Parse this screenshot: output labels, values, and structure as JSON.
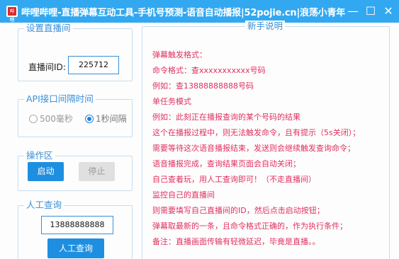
{
  "window": {
    "icon_text": "哔哩",
    "title": "哔哩哔哩-直播弹幕互动工具-手机号预测-语音自动播报|52pojie.cn|浪荡小青年",
    "minimize_glyph": "—",
    "maximize_glyph": "☐",
    "close_glyph": "✕"
  },
  "set_room": {
    "legend": "设置直播间",
    "label": "直播间ID:",
    "room_id": "225712"
  },
  "api_interval": {
    "legend": "API接口间隔时间",
    "options": [
      {
        "label": "500毫秒",
        "checked": false
      },
      {
        "label": "1秒间隔",
        "checked": true
      }
    ]
  },
  "operations": {
    "legend": "操作区",
    "start_label": "启动",
    "stop_label": "停止"
  },
  "manual_query": {
    "legend": "人工查询",
    "phone": "13888888888",
    "button_label": "人工查询"
  },
  "help": {
    "legend": "新手说明",
    "lines": [
      "弹幕触发格式：",
      "命令格式：查xxxxxxxxxxx号码",
      "例如：查13888888888号码",
      "单任务模式",
      "例如：此刻正在播报查询的某个号码的结果",
      "这个在播报过程中，则无法触发命令，且有提示（5s关闭）；",
      "需要等待这次语音播报结束，发送则会继续触发查询命令；",
      "语音播报完成，查询结果页面会自动关闭；",
      "自己查着玩，用人工查询即可！（不走直播间）",
      "监控自己的直播间",
      "则需要填写自己直播间的ID，然后点击启动按钮；",
      "弹幕取最新的一条，且命令格式正确的，作为执行条件；",
      "备注：直播画面传输有轻微延迟，毕竟是直播。。"
    ]
  },
  "colors": {
    "titlebar": "#32a8f0",
    "accent": "#1e8fe0",
    "help_text": "#e03060",
    "legend_text": "#3a8fd8"
  }
}
